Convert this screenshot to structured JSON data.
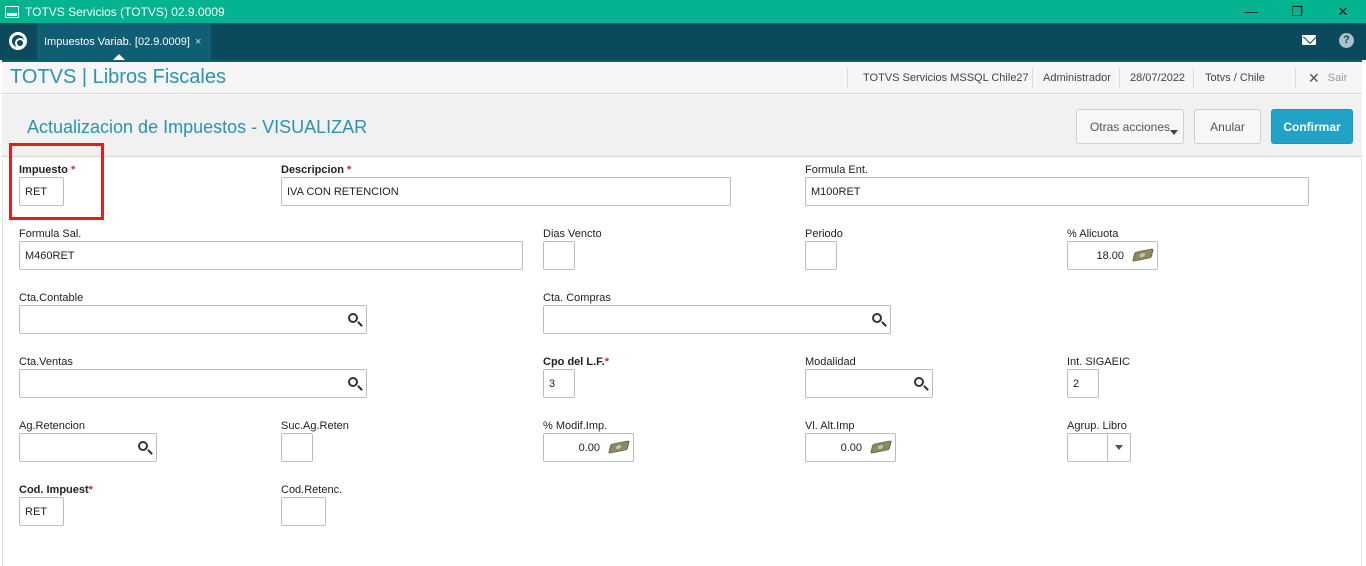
{
  "window": {
    "title": "TOTVS Servicios (TOTVS) 02.9.0009",
    "minimize": "—",
    "restore": "❐",
    "close": "✕"
  },
  "tabs": [
    {
      "label": "Impuestos Variab. [02.9.0009]",
      "close": "×"
    }
  ],
  "header": {
    "app_name": "TOTVS | Libros Fiscales",
    "environment": "TOTVS Servicios MSSQL Chile27",
    "user": "Administrador",
    "date": "28/07/2022",
    "company": "Totvs / Chile",
    "exit_label": "Sair"
  },
  "form": {
    "title": "Actualizacion de Impuestos - VISUALIZAR",
    "buttons": {
      "other_actions": "Otras acciones",
      "cancel": "Anular",
      "confirm": "Confirmar"
    },
    "fields": {
      "impuesto": {
        "label": "Impuesto",
        "required": "*",
        "value": "RET"
      },
      "descripcion": {
        "label": "Descripcion",
        "required": "*",
        "value": "IVA CON RETENCION"
      },
      "formula_ent": {
        "label": "Formula Ent.",
        "value": "M100RET"
      },
      "formula_sal": {
        "label": "Formula Sal.",
        "value": "M460RET"
      },
      "dias_vencto": {
        "label": "Dias Vencto",
        "value": ""
      },
      "periodo": {
        "label": "Periodo",
        "value": ""
      },
      "alicuota": {
        "label": "% Alicuota",
        "value": "18.00"
      },
      "cta_contable": {
        "label": "Cta.Contable",
        "value": ""
      },
      "cta_compras": {
        "label": "Cta. Compras",
        "value": ""
      },
      "cta_ventas": {
        "label": "Cta.Ventas",
        "value": ""
      },
      "cpo_lf": {
        "label": "Cpo del L.F.",
        "required": "*",
        "value": "3"
      },
      "modalidad": {
        "label": "Modalidad",
        "value": ""
      },
      "int_sigaeic": {
        "label": "Int. SIGAEIC",
        "value": "2"
      },
      "ag_retencion": {
        "label": "Ag.Retencion",
        "value": ""
      },
      "suc_ag_reten": {
        "label": "Suc.Ag.Reten",
        "value": ""
      },
      "modif_imp": {
        "label": "% Modif.Imp.",
        "value": "0.00"
      },
      "vl_alt_imp": {
        "label": "Vl. Alt.Imp",
        "value": "0.00"
      },
      "agrup_libro": {
        "label": "Agrup. Libro",
        "value": ""
      },
      "cod_impuest": {
        "label": "Cod. Impuest",
        "required": "*",
        "value": "RET"
      },
      "cod_retenc": {
        "label": "Cod.Retenc.",
        "value": ""
      }
    }
  },
  "colors": {
    "titlebar": "#04b38f",
    "tabbar": "#0b4a5d",
    "accent": "#2a93b3",
    "confirm_button": "#21a3c7",
    "highlight": "#e0201c"
  },
  "icons": [
    "app-icon",
    "home-icon",
    "mail-icon",
    "help-icon",
    "close-icon",
    "search-icon",
    "money-icon",
    "chevron-down-icon"
  ]
}
